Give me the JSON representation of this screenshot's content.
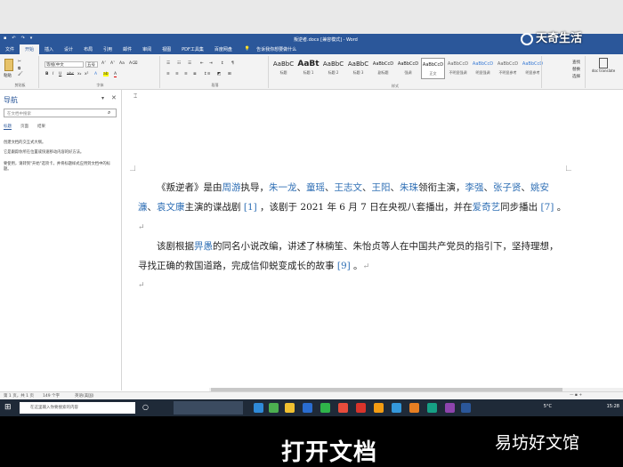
{
  "window": {
    "title": "叛逆者.docx [兼容模式] - Word"
  },
  "tabs": [
    "文件",
    "开始",
    "插入",
    "设计",
    "布局",
    "引用",
    "邮件",
    "审阅",
    "视图",
    "PDF工具集",
    "百度网盘"
  ],
  "tell_me": "告诉我你想要做什么",
  "ribbon": {
    "font_name": "等线(中文",
    "font_size": "五号",
    "paste_label": "粘贴",
    "clipboard_group": "剪贴板",
    "font_group": "字体",
    "paragraph_group": "段落",
    "styles_group": "样式",
    "styles": [
      {
        "sample": "AaBbC",
        "name": "标题"
      },
      {
        "sample": "AaBt",
        "name": "标题 1"
      },
      {
        "sample": "AaBbC",
        "name": "标题 2"
      },
      {
        "sample": "AaBbC",
        "name": "标题 3"
      },
      {
        "sample": "AaBbCcD",
        "name": "副标题"
      },
      {
        "sample": "AaBbCcD",
        "name": "强调"
      },
      {
        "sample": "AaBbCcD",
        "name": "正文"
      },
      {
        "sample": "AaBbCcD",
        "name": "不明显强调"
      },
      {
        "sample": "AaBbCcD",
        "name": "明显强调"
      },
      {
        "sample": "AaBbCcD",
        "name": "不明显参考"
      },
      {
        "sample": "AaBbCcD",
        "name": "明显参考"
      }
    ],
    "find": "查找",
    "replace": "替换",
    "select": "选择",
    "translate": "doc translate"
  },
  "nav": {
    "title": "导航",
    "search_placeholder": "在文档中搜索",
    "tabs": [
      "标题",
      "页面",
      "结果"
    ],
    "text1": "创建文档的交互式大纲。",
    "text2": "它是跟踪你所在位置或快速移动内容的好方法。",
    "text3": "要使用，请转到\"开始\"选项卡，并将标题样式应用到文档中的标题。"
  },
  "document": {
    "p1": [
      {
        "t": "《叛逆者》是由",
        "l": false
      },
      {
        "t": "周游",
        "l": true
      },
      {
        "t": "执导，",
        "l": false
      },
      {
        "t": "朱一龙",
        "l": true
      },
      {
        "t": "、",
        "l": false
      },
      {
        "t": "童瑶",
        "l": true
      },
      {
        "t": "、",
        "l": false
      },
      {
        "t": "王志文",
        "l": true
      },
      {
        "t": "、",
        "l": false
      },
      {
        "t": "王阳",
        "l": true
      },
      {
        "t": "、",
        "l": false
      },
      {
        "t": "朱珠",
        "l": true
      },
      {
        "t": "领衔主演，",
        "l": false
      },
      {
        "t": "李强",
        "l": true
      },
      {
        "t": "、",
        "l": false
      },
      {
        "t": "张子贤",
        "l": true
      },
      {
        "t": "、",
        "l": false
      },
      {
        "t": "姚安濂",
        "l": true
      },
      {
        "t": "、",
        "l": false
      },
      {
        "t": "袁文康",
        "l": true
      },
      {
        "t": "主演的谍战剧 ",
        "l": false
      },
      {
        "t": "[1]",
        "l": true
      },
      {
        "t": " ，该剧于 2021 年 6 月 7 日在央视八套播出，并在",
        "l": false
      },
      {
        "t": "爱奇艺",
        "l": true
      },
      {
        "t": "同步播出 ",
        "l": false
      },
      {
        "t": "[7]",
        "l": true
      },
      {
        "t": " 。",
        "l": false
      }
    ],
    "p2": [
      {
        "t": "该剧根据",
        "l": false
      },
      {
        "t": "畀愚",
        "l": true
      },
      {
        "t": "的同名小说改编，讲述了林楠笙、朱怡贞等人在中国共产党员的指引下，坚持理想，寻找正确的救国道路，完成信仰蜕变成长的故事 ",
        "l": false
      },
      {
        "t": "[9]",
        "l": true
      },
      {
        "t": " 。",
        "l": false
      }
    ],
    "return_mark": "↵"
  },
  "status": {
    "page": "第 1 页，共 1 页",
    "words": "149 个字",
    "lang": "英语(美国)"
  },
  "taskbar": {
    "search_placeholder": "在这里输入你要搜索的内容",
    "weather": "5°C",
    "time": "15:28"
  },
  "overlay": {
    "brand": "天奇生活",
    "caption": "打开文档",
    "watermark": "易坊好文馆"
  },
  "colors": {
    "word_blue": "#2b579a",
    "link": "#2f6fb5",
    "taskbar": "#1f2a38"
  }
}
